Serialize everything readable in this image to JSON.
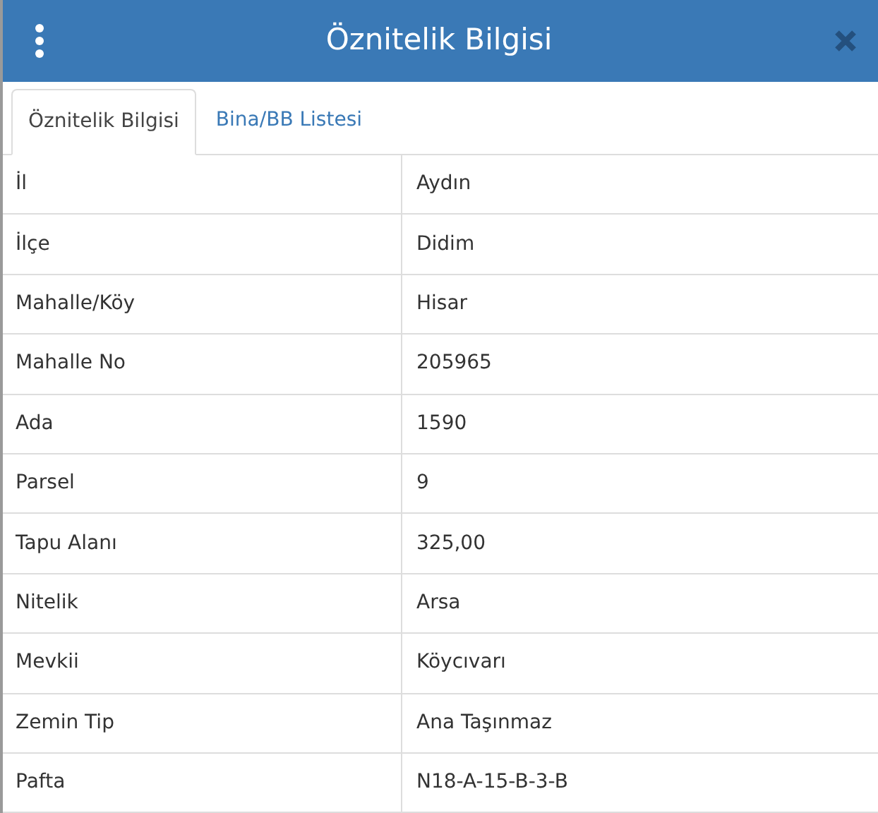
{
  "window": {
    "title": "Öznitelik Bilgisi"
  },
  "tabs": [
    {
      "label": "Öznitelik Bilgisi",
      "selected": true
    },
    {
      "label": "Bina/BB Listesi",
      "selected": false
    }
  ],
  "table": {
    "rows": [
      {
        "label": "İl",
        "value": "Aydın"
      },
      {
        "label": "İlçe",
        "value": "Didim"
      },
      {
        "label": "Mahalle/Köy",
        "value": "Hisar"
      },
      {
        "label": "Mahalle No",
        "value": "205965"
      },
      {
        "label": "Ada",
        "value": "1590"
      },
      {
        "label": "Parsel",
        "value": "9"
      },
      {
        "label": "Tapu Alanı",
        "value": "325,00"
      },
      {
        "label": "Nitelik",
        "value": "Arsa"
      },
      {
        "label": "Mevkii",
        "value": "Köycıvarı"
      },
      {
        "label": "Zemin Tip",
        "value": "Ana Taşınmaz"
      },
      {
        "label": "Pafta",
        "value": "N18-A-15-B-3-B"
      }
    ]
  }
}
